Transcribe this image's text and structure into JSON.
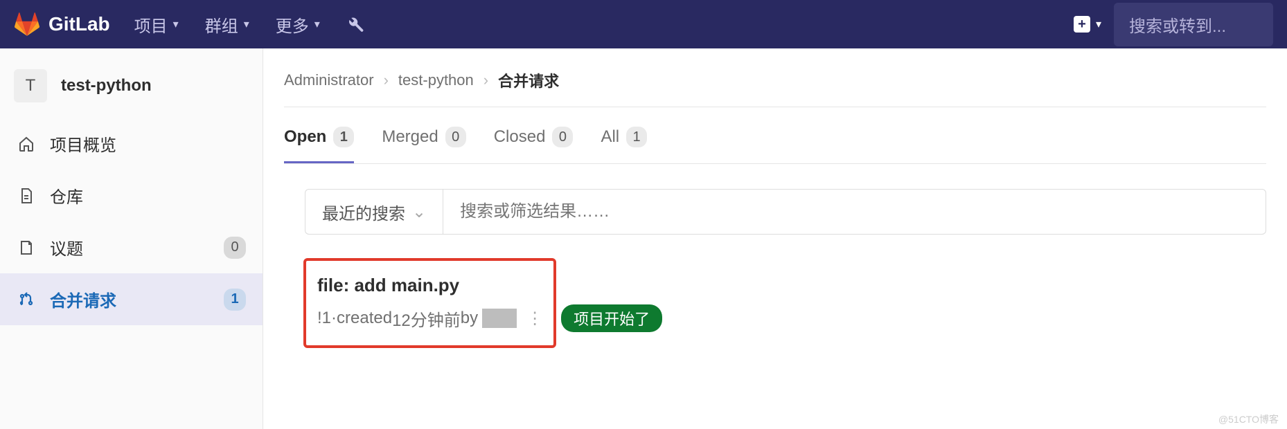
{
  "navbar": {
    "brand": "GitLab",
    "items": [
      {
        "label": "项目"
      },
      {
        "label": "群组"
      },
      {
        "label": "更多"
      }
    ],
    "search_placeholder": "搜索或转到..."
  },
  "sidebar": {
    "project_avatar_letter": "T",
    "project_name": "test-python",
    "items": [
      {
        "icon": "home",
        "label": "项目概览",
        "badge": null,
        "active": false
      },
      {
        "icon": "file",
        "label": "仓库",
        "badge": null,
        "active": false
      },
      {
        "icon": "doc",
        "label": "议题",
        "badge": "0",
        "active": false
      },
      {
        "icon": "merge",
        "label": "合并请求",
        "badge": "1",
        "active": true
      }
    ]
  },
  "breadcrumb": {
    "items": [
      "Administrator",
      "test-python"
    ],
    "current": "合并请求"
  },
  "tabs": [
    {
      "label": "Open",
      "count": "1",
      "active": true
    },
    {
      "label": "Merged",
      "count": "0",
      "active": false
    },
    {
      "label": "Closed",
      "count": "0",
      "active": false
    },
    {
      "label": "All",
      "count": "1",
      "active": false
    }
  ],
  "filter": {
    "recent_label": "最近的搜索",
    "input_placeholder": "搜索或筛选结果……"
  },
  "merge_request": {
    "title": "file: add main.py",
    "id": "!1",
    "sep": " · ",
    "created_prefix": "created ",
    "created_time": "12分钟前",
    "by_text": " by",
    "label": "项目开始了"
  },
  "watermark": "@51CTO博客"
}
